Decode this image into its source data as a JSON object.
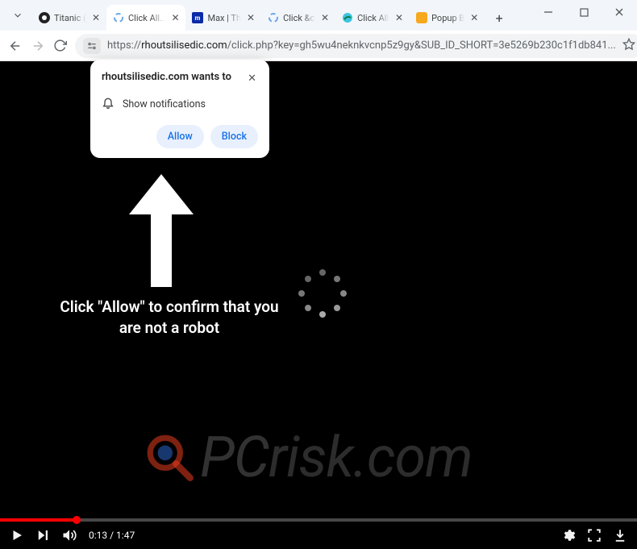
{
  "tabs": [
    {
      "label": "Titanic (",
      "active": false,
      "icon": "hbo"
    },
    {
      "label": "Click All…",
      "active": true,
      "icon": "spin"
    },
    {
      "label": "Max | Th",
      "active": false,
      "icon": "max"
    },
    {
      "label": "Click &c",
      "active": false,
      "icon": "spin"
    },
    {
      "label": "Click All",
      "active": false,
      "icon": "edge"
    },
    {
      "label": "Popup B",
      "active": false,
      "icon": "bullet"
    }
  ],
  "url": {
    "scheme": "https://",
    "host": "rhoutsilisedic.com",
    "path": "/click.php?key=gh5wu4neknkvcnp5z9gy&SUB_ID_SHORT=3e5269b230c1f1db841..."
  },
  "permission": {
    "title": "rhoutsilisedic.com wants to",
    "line": "Show notifications",
    "allow": "Allow",
    "block": "Block"
  },
  "page": {
    "message": "Click \"Allow\" to confirm that you are not a robot"
  },
  "player": {
    "current": "0:13",
    "sep": " / ",
    "total": "1:47",
    "progress_pct": 12
  },
  "watermark": {
    "text_a": "PC",
    "text_b": "risk.com"
  }
}
